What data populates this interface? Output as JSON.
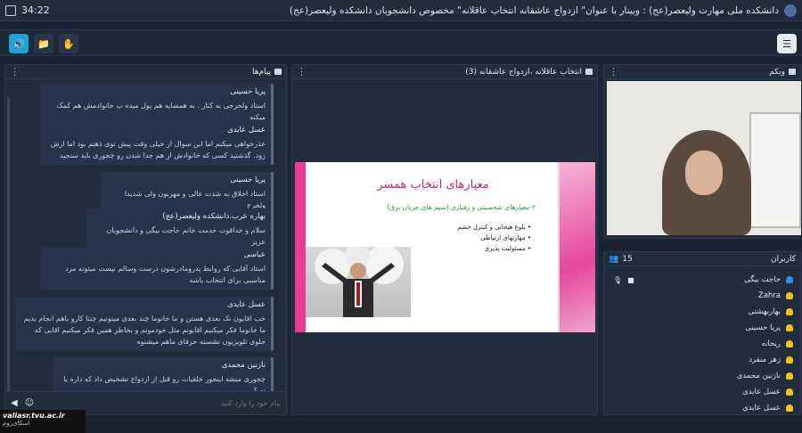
{
  "topbar": {
    "time": "34:22",
    "title": "دانشکده ملی مهارت ولیعصر(عج) : وبینار با عنوان\" ازدواج عاشقانه انتخاب عاقلانه\" مخصوص دانشجویان دانشکده ولیعصر(عج)"
  },
  "chat": {
    "title": "پیام‌ها",
    "placeholder": "پیام خود را وارد کنید",
    "messages": [
      {
        "name": "پریا حسینی",
        "text": "استاد ولخرجی به کنار . به همسایه هم پول میده ب خانوادمش هم کمک میکنه"
      },
      {
        "name": "عسل عابدی",
        "text": "عذرخواهی میکنم اما این سوال از خیلی وقت پیش توی ذهنم بود اما ازش زود. گذشتید کسی که خانوادش از هم جدا شدن رو چجوری باید سنجید"
      },
      {
        "name": "پریا حسینی",
        "text": "استاد اخلاق به شدت عالی و مهربون ولی شدیدا ولخرج"
      },
      {
        "name": "بهاره عرب.دانشکده ولیعصر(عج)",
        "text": "سلام و خداقوت خدمت خانم حاجت بیگی و دانشجویان عزیز"
      },
      {
        "name": "عباسی",
        "text": "استاد آقایی که روابط پدرومادرشون درست وسالم نیست میتونه مرد مناسبی برای انتخاب باشه"
      },
      {
        "name": "عسل عابدی",
        "text": "خب اقایون تک بعدی هستن و ما خانوما چند بعدی میتونیم چنتا کارو باهم انجام بدیم ما خانوما فکر میکنیم اقایونم مثل خودمونم و بخاطر همین فکر میکنیم اقایی که جلوی تلویزیون نشسته حرفای ماهم میشنوه"
      },
      {
        "name": "نازنین محمدی",
        "text": "چجوری میشه اینجور خلقیات رو قبل از ازدواج تشخیص داد که داره یا نه ؟"
      }
    ]
  },
  "content": {
    "title": "انتخاب عاقلانه ،ازدواج عاشقانه (3)"
  },
  "slide": {
    "title": "معیارهای انتخاب همسر",
    "subtitle": "۲-معیارهای شخصیتی و رفتاری (سیم های جریان برق)",
    "bullets": [
      "بلوغ هیجانی و کنترل خشم",
      "مهارتهای ارتباطی",
      "مسئولیت پذیری"
    ]
  },
  "webcam": {
    "title": "وبکم"
  },
  "users": {
    "title": "کاربران",
    "count": "15",
    "list": [
      {
        "name": "حاجت بیگی",
        "color": "#2f8fe0"
      },
      {
        "name": "Zahra",
        "color": "#f0c419"
      },
      {
        "name": "بهاربهشتی",
        "color": "#f0c419"
      },
      {
        "name": "پریا حسینی",
        "color": "#f0c419"
      },
      {
        "name": "ریحانه",
        "color": "#f0c419"
      },
      {
        "name": "زهر منفرد",
        "color": "#f0c419"
      },
      {
        "name": "نازنین محمدی",
        "color": "#f0c419"
      },
      {
        "name": "عسل عابدی",
        "color": "#f0c419"
      },
      {
        "name": "عسل عابدی",
        "color": "#f0c419"
      }
    ]
  },
  "watermark": {
    "site": "valiasr.tvu.ac.ir",
    "brand": "اسکای‌روم"
  }
}
